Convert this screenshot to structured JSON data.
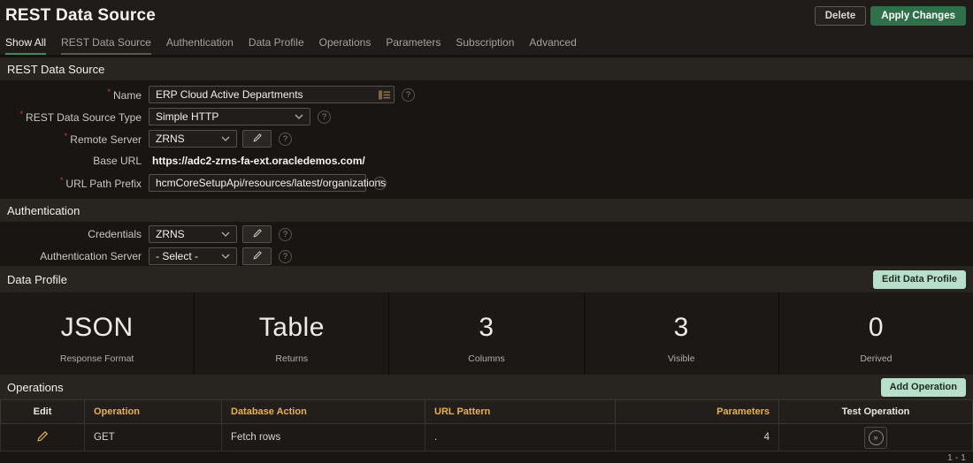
{
  "header": {
    "title": "REST Data Source",
    "buttons": {
      "delete": "Delete",
      "apply": "Apply Changes"
    }
  },
  "tabs": [
    {
      "label": "Show All"
    },
    {
      "label": "REST Data Source"
    },
    {
      "label": "Authentication"
    },
    {
      "label": "Data Profile"
    },
    {
      "label": "Operations"
    },
    {
      "label": "Parameters"
    },
    {
      "label": "Subscription"
    },
    {
      "label": "Advanced"
    }
  ],
  "rest_section": {
    "title": "REST Data Source",
    "name": {
      "label": "Name",
      "value": "ERP Cloud Active Departments"
    },
    "source_type": {
      "label": "REST Data Source Type",
      "value": "Simple HTTP"
    },
    "remote_server": {
      "label": "Remote Server",
      "value": "ZRNS"
    },
    "base_url": {
      "label": "Base URL",
      "value": "https://adc2-zrns-fa-ext.oracledemos.com/"
    },
    "url_path_prefix": {
      "label": "URL Path Prefix",
      "value": "hcmCoreSetupApi/resources/latest/organizations"
    }
  },
  "auth_section": {
    "title": "Authentication",
    "credentials": {
      "label": "Credentials",
      "value": "ZRNS"
    },
    "auth_server": {
      "label": "Authentication Server",
      "value": "- Select -"
    }
  },
  "data_profile": {
    "title": "Data Profile",
    "edit_button": "Edit Data Profile",
    "stats": [
      {
        "value": "JSON",
        "label": "Response Format"
      },
      {
        "value": "Table",
        "label": "Returns"
      },
      {
        "value": "3",
        "label": "Columns"
      },
      {
        "value": "3",
        "label": "Visible"
      },
      {
        "value": "0",
        "label": "Derived"
      }
    ]
  },
  "operations": {
    "title": "Operations",
    "add_button": "Add Operation",
    "columns": [
      "Edit",
      "Operation",
      "Database Action",
      "URL Pattern",
      "Parameters",
      "Test Operation"
    ],
    "rows": [
      {
        "operation": "GET",
        "database_action": "Fetch rows",
        "url_pattern": ".",
        "parameters": "4"
      }
    ],
    "pagination": "1 - 1"
  },
  "icons": {
    "help": "?",
    "required": "*"
  },
  "colors": {
    "accent_green": "#2e7049",
    "tab_active_underline": "#43885f",
    "mint": "#b7dfc9",
    "gold": "#e7b24b",
    "required_red": "#c7463f"
  }
}
